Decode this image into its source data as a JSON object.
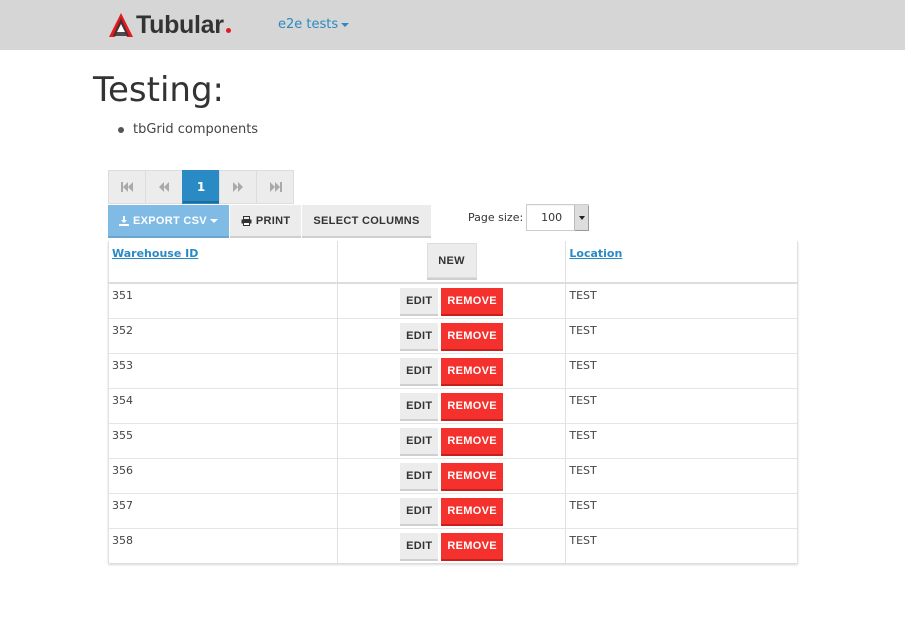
{
  "navbar": {
    "brand": "Tubular",
    "menu_label": "e2e tests"
  },
  "main": {
    "title": "Testing:",
    "bullets": [
      "tbGrid components"
    ]
  },
  "pager": {
    "current_page": "1"
  },
  "toolbar": {
    "export_label": "EXPORT CSV",
    "print_label": "PRINT",
    "select_columns_label": "SELECT COLUMNS"
  },
  "page_size": {
    "label": "Page size:",
    "value": "100"
  },
  "grid": {
    "columns": [
      "Warehouse ID",
      "Location"
    ],
    "new_label": "NEW",
    "edit_label": "EDIT",
    "remove_label": "REMOVE",
    "rows": [
      {
        "id": "351",
        "location": "TEST"
      },
      {
        "id": "352",
        "location": "TEST"
      },
      {
        "id": "353",
        "location": "TEST"
      },
      {
        "id": "354",
        "location": "TEST"
      },
      {
        "id": "355",
        "location": "TEST"
      },
      {
        "id": "356",
        "location": "TEST"
      },
      {
        "id": "357",
        "location": "TEST"
      },
      {
        "id": "358",
        "location": "TEST"
      }
    ]
  },
  "colors": {
    "accent": "#2a8ac4",
    "danger": "#f4312c",
    "navbar_bg": "#d6d6d6"
  }
}
